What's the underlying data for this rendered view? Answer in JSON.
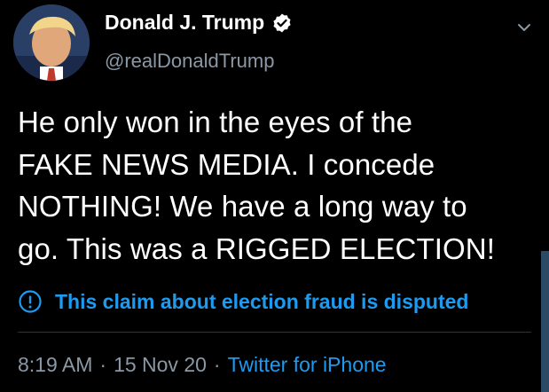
{
  "author": {
    "display_name": "Donald J. Trump",
    "handle": "@realDonaldTrump",
    "verified_icon": "verified-badge-icon",
    "avatar": "profile-photo"
  },
  "tweet": {
    "lines": [
      "He only won in the eyes of the",
      "FAKE NEWS MEDIA. I concede",
      "NOTHING! We have a long way to",
      "go. This was a RIGGED ELECTION!"
    ],
    "notice": "This claim about election fraud is disputed",
    "time": "8:19 AM",
    "date": "15 Nov 20",
    "source": "Twitter for iPhone",
    "separator": "·"
  },
  "colors": {
    "background": "#000000",
    "text": "#ffffff",
    "secondary": "#8b98a5",
    "accent": "#1d9bf0"
  }
}
